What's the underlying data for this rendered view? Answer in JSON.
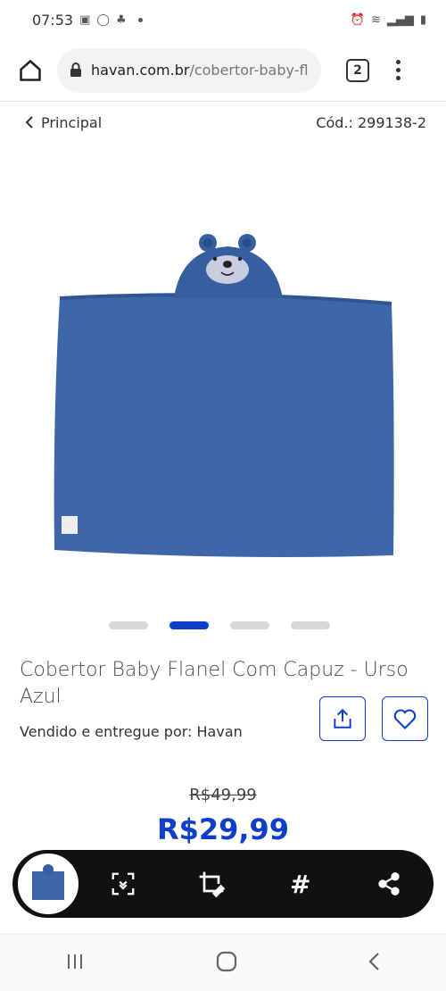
{
  "status_bar": {
    "time": "07:53"
  },
  "browser": {
    "url_domain": "havan.com.br",
    "url_path": "/cobertor-baby-fl",
    "tab_count": "2"
  },
  "breadcrumb": {
    "back_label": "Principal",
    "code": "Cód.: 299138-2"
  },
  "product": {
    "title": "Cobertor Baby Flanel Com Capuz - Urso Azul",
    "seller": "Vendido e entregue por: Havan",
    "old_price": "R$49,99",
    "price": "R$29,99",
    "image_count": 4,
    "active_image": 2
  },
  "colors": {
    "accent": "#0f3ec9",
    "blanket": "#3d67a8"
  },
  "icons": {
    "home": "home-icon",
    "lock": "lock-icon",
    "share": "share-icon",
    "favorite": "heart-icon",
    "scroll_capture": "scroll-capture-icon",
    "crop_edit": "crop-edit-icon",
    "tag": "hashtag-icon",
    "share_screenshot": "share-nodes-icon"
  }
}
